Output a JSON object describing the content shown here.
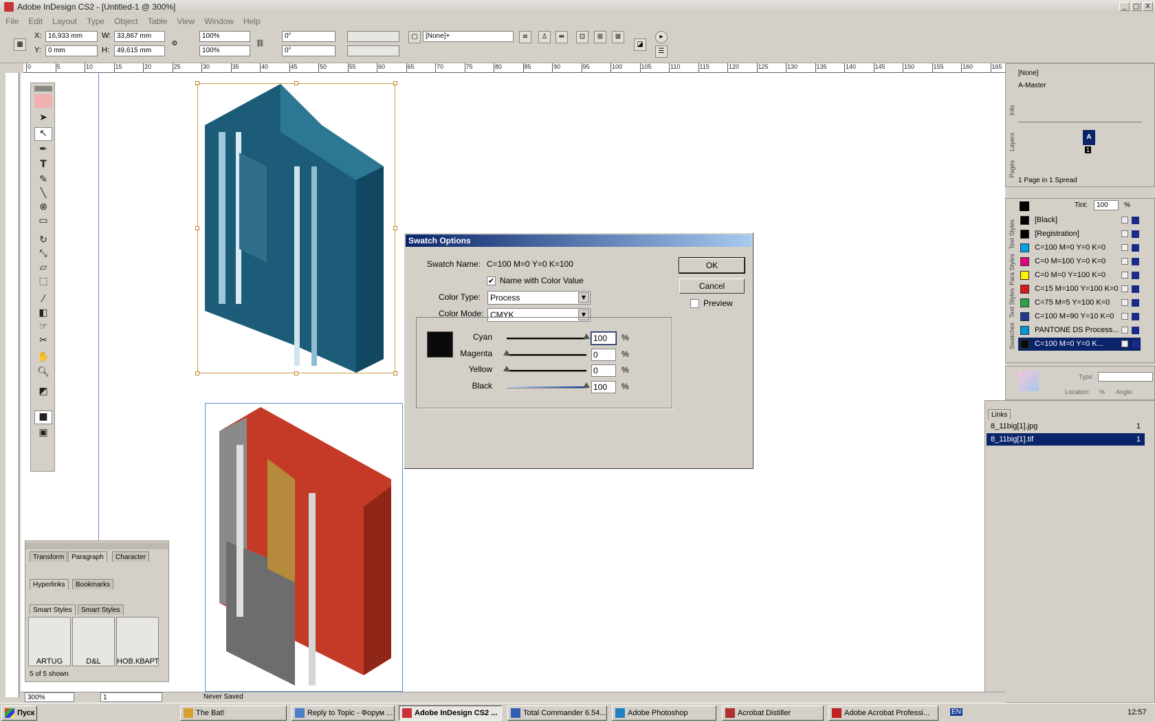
{
  "window": {
    "title": "Adobe InDesign CS2 - [Untitled-1 @ 300%]",
    "controls": [
      "_",
      "□",
      "X"
    ]
  },
  "menu": [
    "File",
    "Edit",
    "Layout",
    "Type",
    "Object",
    "Table",
    "View",
    "Window",
    "Help"
  ],
  "control_panel": {
    "x_label": "X:",
    "x_value": "16,933 mm",
    "y_label": "Y:",
    "y_value": "0 mm",
    "w_label": "W:",
    "w_value": "33,867 mm",
    "h_label": "H:",
    "h_value": "49,615 mm",
    "scale_x": "100%",
    "scale_y": "100%",
    "rotate": "0°",
    "shear": "0°",
    "stroke_style": "[None]+"
  },
  "ruler": {
    "labels": [
      "0",
      "5",
      "10",
      "15",
      "20",
      "25",
      "30",
      "35",
      "40",
      "45",
      "50",
      "55",
      "60",
      "65",
      "70",
      "75",
      "80",
      "85",
      "90",
      "95",
      "100",
      "105",
      "110",
      "115",
      "120",
      "125",
      "130",
      "135",
      "140",
      "145",
      "150",
      "155",
      "160",
      "165"
    ]
  },
  "dialog": {
    "title": "Swatch Options",
    "swatch_name_label": "Swatch Name:",
    "swatch_name": "C=100 M=0 Y=0 K=100",
    "name_with_color_value": "Name with Color Value",
    "name_with_color_checked": "✔",
    "color_type_label": "Color Type:",
    "color_type": "Process",
    "color_mode_label": "Color Mode:",
    "color_mode": "CMYK",
    "ok": "OK",
    "cancel": "Cancel",
    "preview": "Preview",
    "pct": "%",
    "channels": [
      {
        "name": "Cyan",
        "value": "100",
        "level": 1.0
      },
      {
        "name": "Magenta",
        "value": "0",
        "level": 0.0
      },
      {
        "name": "Yellow",
        "value": "0",
        "level": 0.0
      },
      {
        "name": "Black",
        "value": "100",
        "level": 1.0
      }
    ],
    "preview_color": "#0a0a0a"
  },
  "pages_panel": {
    "none": "[None]",
    "master": "A-Master",
    "page_letter": "A",
    "page_number": "1",
    "footer": "1 Page in 1 Spread",
    "tabs": [
      "Info",
      "Layers",
      "Pages"
    ]
  },
  "swatches_panel": {
    "tint_label": "Tint:",
    "tint_value": "100",
    "tint_pct": "%",
    "tabs": [
      "Swatches",
      "Text Styles",
      "Para Styles",
      "Text Styles"
    ],
    "items": [
      {
        "name": "[Black]",
        "color": "#000000"
      },
      {
        "name": "[Registration]",
        "color": "#000000"
      },
      {
        "name": "C=100 M=0 Y=0 K=0",
        "color": "#00a0e9"
      },
      {
        "name": "C=0 M=100 Y=0 K=0",
        "color": "#e4007f"
      },
      {
        "name": "C=0 M=0 Y=100 K=0",
        "color": "#fff100"
      },
      {
        "name": "C=15 M=100 Y=100 K=0",
        "color": "#d7191f"
      },
      {
        "name": "C=75 M=5 Y=100 K=0",
        "color": "#2ba243"
      },
      {
        "name": "C=100 M=90 Y=10 K=0",
        "color": "#1e3a8e"
      },
      {
        "name": "PANTONE DS Process...",
        "color": "#0097d6"
      },
      {
        "name": "C=100 M=0 Y=0 K...",
        "color": "#0a0a0a"
      }
    ]
  },
  "gradient_panel": {
    "type_label": "Type:",
    "location_label": "Location:",
    "pct": "%",
    "angle_label": "Angle:"
  },
  "links_panel": {
    "title": "Links",
    "items": [
      {
        "name": "8_11big[1].jpg",
        "page": "1"
      },
      {
        "name": "8_11big[1].tif",
        "page": "1"
      }
    ]
  },
  "left_panels": {
    "tabs1": [
      "Transform",
      "Paragraph",
      "Character"
    ],
    "tabs2": [
      "Hyperlinks",
      "Bookmarks"
    ],
    "tabs3": [
      "Smart Styles",
      "Smart Styles"
    ],
    "styles": [
      "ARTUG",
      "D&L",
      "НОВ.КВАРТ"
    ],
    "footer": "5 of 5 shown"
  },
  "status": {
    "zoom": "300%",
    "page": "1",
    "save_state": "Never Saved"
  },
  "taskbar": {
    "start": "Пуск",
    "tasks": [
      "The Bat!",
      "Reply to Topic - Форум ...",
      "Adobe InDesign CS2 ...",
      "Total Commander 6.54...",
      "Adobe Photoshop",
      "Acrobat Distiller",
      "Adobe Acrobat Professi..."
    ],
    "lang": "EN",
    "clock": "12:57"
  }
}
